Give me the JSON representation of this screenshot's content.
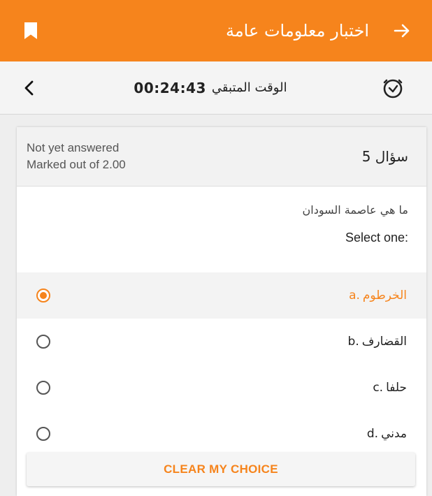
{
  "appbar": {
    "title": "اختبار معلومات عامة",
    "bookmark_icon": "bookmark-icon",
    "back_icon": "arrow-right-icon",
    "color": "#f6841c"
  },
  "timer": {
    "label": "الوقت المتبقي",
    "value": "00:24:43",
    "chevron_icon": "chevron-left-icon",
    "timer_icon": "timer-icon"
  },
  "question": {
    "number_label": "سؤال 5",
    "status": "Not yet answered",
    "mark": "Marked out of 2.00",
    "text": "ما هي عاصمة السودان",
    "instruction": "Select one:"
  },
  "options": [
    {
      "letter": "a.",
      "text": "الخرطوم",
      "selected": true
    },
    {
      "letter": "b.",
      "text": "القضارف",
      "selected": false
    },
    {
      "letter": "c.",
      "text": "حلفا",
      "selected": false
    },
    {
      "letter": "d.",
      "text": "مدني",
      "selected": false
    }
  ],
  "clear_button": {
    "label": "CLEAR MY CHOICE"
  }
}
